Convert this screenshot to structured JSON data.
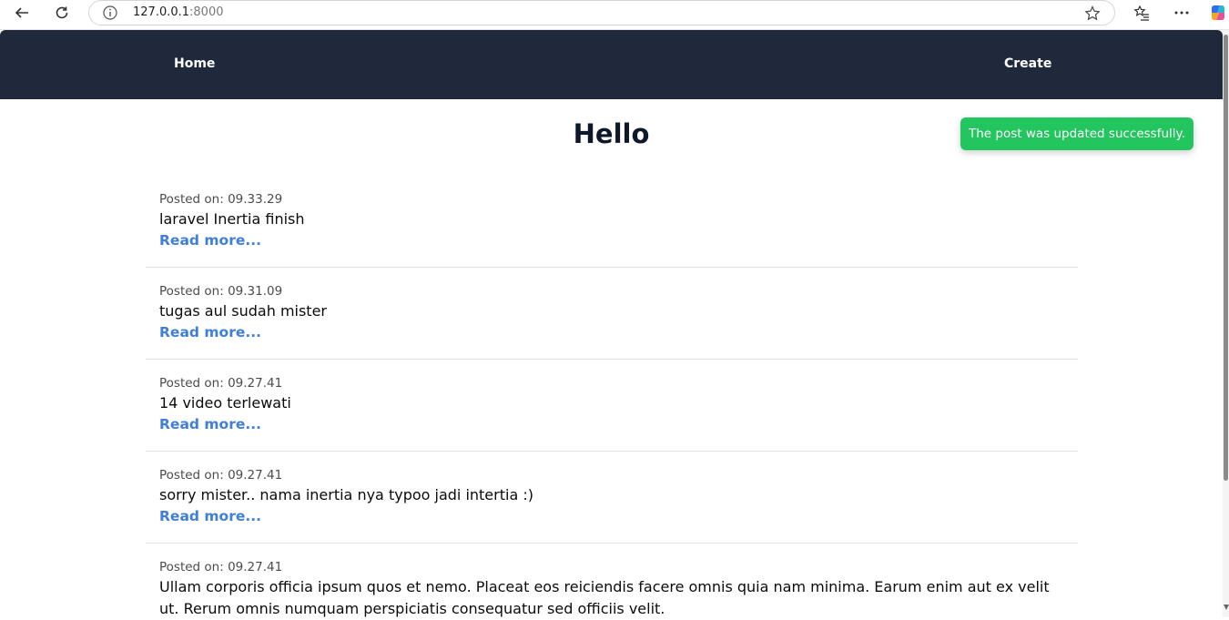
{
  "browser": {
    "url_host": "127.0.0.1",
    "url_port": ":8000"
  },
  "nav": {
    "home_label": "Home",
    "create_label": "Create"
  },
  "page": {
    "title": "Hello"
  },
  "toast": {
    "message": "The post was updated successfully.",
    "color": "#22c55e"
  },
  "posts": [
    {
      "posted_on": "Posted on: 09.33.29",
      "title": "laravel Inertia finish",
      "read_more": "Read more..."
    },
    {
      "posted_on": "Posted on: 09.31.09",
      "title": "tugas aul sudah mister",
      "read_more": "Read more..."
    },
    {
      "posted_on": "Posted on: 09.27.41",
      "title": "14 video terlewati",
      "read_more": "Read more..."
    },
    {
      "posted_on": "Posted on: 09.27.41",
      "title": "sorry mister.. nama inertia nya typoo jadi intertia :)",
      "read_more": "Read more..."
    },
    {
      "posted_on": "Posted on: 09.27.41",
      "title": "Ullam corporis officia ipsum quos et nemo. Placeat eos reiciendis facere omnis quia nam minima. Earum enim aut ex velit ut. Rerum omnis numquam perspiciatis consequatur sed officiis velit."
    }
  ],
  "colors": {
    "nav_bg": "#1f293b",
    "link": "#3f7fd6",
    "title": "#0f172a"
  }
}
